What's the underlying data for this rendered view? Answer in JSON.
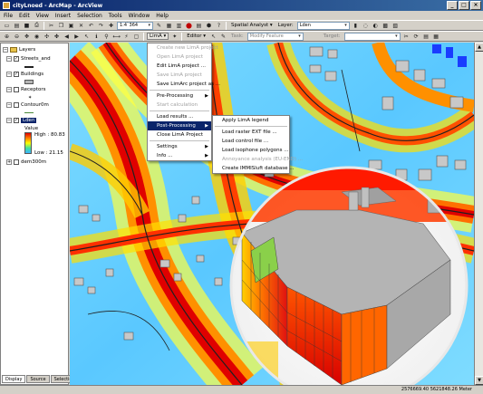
{
  "window": {
    "title": "cityLnoed - ArcMap - ArcView",
    "buttons": [
      "_",
      "□",
      "×"
    ]
  },
  "menubar": [
    "File",
    "Edit",
    "View",
    "Insert",
    "Selection",
    "Tools",
    "Window",
    "Help"
  ],
  "toolbar1": {
    "scale": "1:4`364",
    "spatial_analyst": "Spatial Analyst ▾",
    "layer_label": "Layer:",
    "layer_value": "Lden"
  },
  "toolbar2": {
    "limA": "LimA ▾",
    "editor": "Editor ▾",
    "task_label": "Task:",
    "task_value": "Modify Feature",
    "target_label": "Target:"
  },
  "toc": {
    "root": "Layers",
    "layers": [
      {
        "name": "Streets_and",
        "checked": true
      },
      {
        "name": "Buildings",
        "checked": true
      },
      {
        "name": "Receptors",
        "checked": false
      },
      {
        "name": "Contour0m",
        "checked": false
      },
      {
        "name": "Lden",
        "checked": true,
        "selected": true
      },
      {
        "name": "dem300m",
        "checked": false
      }
    ],
    "lden_value_label": "Value",
    "lden_high": "High : 80.83",
    "lden_low": "Low : 21.15",
    "tabs": [
      "Display",
      "Source",
      "Selection"
    ]
  },
  "main_menu": [
    {
      "label": "Create new LimA project",
      "disabled": true
    },
    {
      "label": "Open LimA project",
      "disabled": true
    },
    {
      "label": "Edit LimA project ...",
      "disabled": false
    },
    {
      "label": "Save LimA project",
      "disabled": true
    },
    {
      "label": "Save LimArc project as ...",
      "disabled": false
    },
    {
      "sep": true
    },
    {
      "label": "Pre-Processing",
      "disabled": false,
      "submenu": true
    },
    {
      "label": "Start calculation",
      "disabled": true
    },
    {
      "sep": true
    },
    {
      "label": "Load results ...",
      "disabled": false
    },
    {
      "label": "Post-Processing",
      "disabled": false,
      "submenu": true,
      "highlight": true
    },
    {
      "label": "Close LimA Project",
      "disabled": false
    },
    {
      "sep": true
    },
    {
      "label": "Settings",
      "disabled": false,
      "submenu": true
    },
    {
      "label": "Info ...",
      "disabled": false,
      "submenu": true
    }
  ],
  "sub_menu": [
    {
      "label": "Apply LimA legend",
      "disabled": false
    },
    {
      "sep": true
    },
    {
      "label": "Load raster EXT file ...",
      "disabled": false
    },
    {
      "label": "Load control file ...",
      "disabled": false
    },
    {
      "label": "Load isophone polygons ...",
      "disabled": false
    },
    {
      "label": "Annoyance analysis (EU-END) ...",
      "disabled": true
    },
    {
      "label": "Create IMMISluft database ...",
      "disabled": false
    }
  ],
  "statusbar": {
    "coords": "2576669.40  5621848.26 Meter"
  },
  "colors": {
    "menu_highlight": "#0a246a",
    "noise_high": "#e00000",
    "noise_low": "#3fb4ff"
  }
}
